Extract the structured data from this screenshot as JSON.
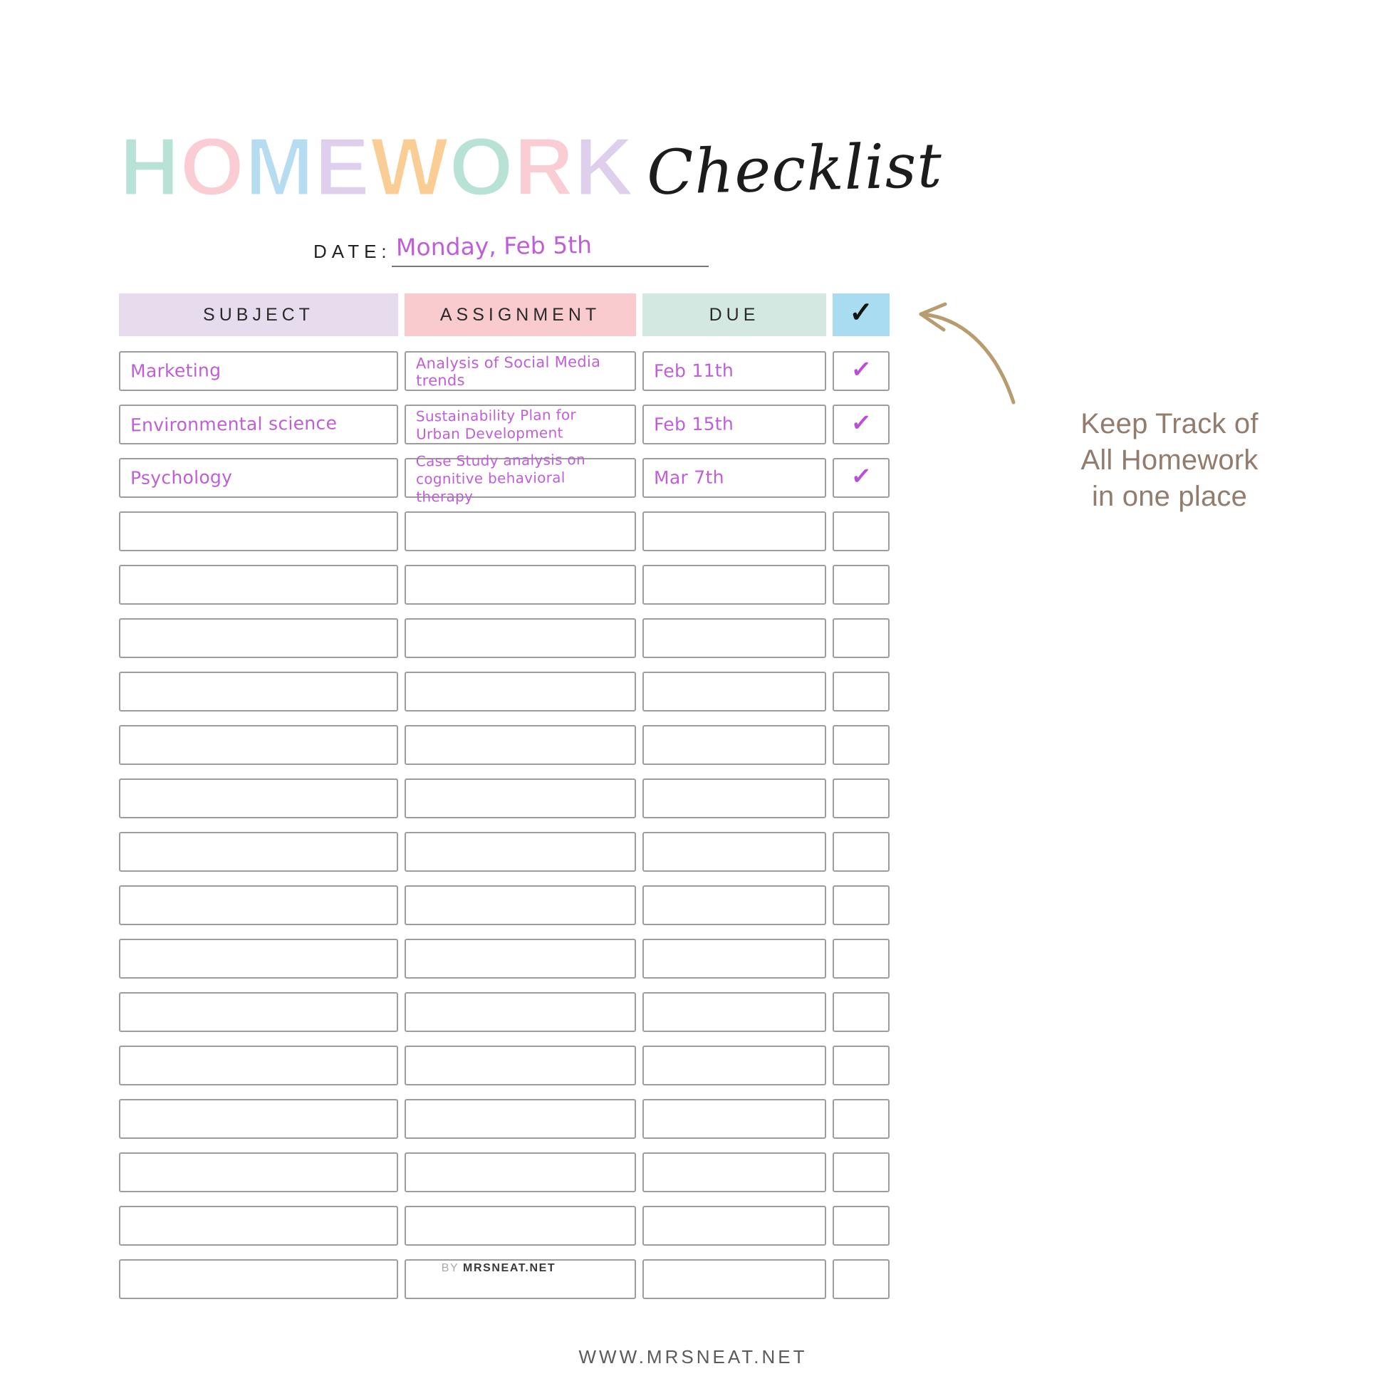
{
  "title": {
    "word_letters": [
      {
        "char": "H",
        "color": "#b9e2d6"
      },
      {
        "char": "O",
        "color": "#f9cdd3"
      },
      {
        "char": "M",
        "color": "#b6dcf2"
      },
      {
        "char": "E",
        "color": "#ded0ec"
      },
      {
        "char": "W",
        "color": "#f9cd93"
      },
      {
        "char": "O",
        "color": "#b9e2d6"
      },
      {
        "char": "R",
        "color": "#f9cdd3"
      },
      {
        "char": "K",
        "color": "#ded0ec"
      }
    ],
    "word_plain": "HOMEWORK",
    "script": "Checklist"
  },
  "date": {
    "label": "DATE:",
    "value": "Monday, Feb 5th",
    "placeholder": ""
  },
  "table": {
    "headers": {
      "subject": "SUBJECT",
      "assignment": "ASSIGNMENT",
      "due": "DUE",
      "check": "✓"
    },
    "header_colors": {
      "subject": "#e7dcee",
      "assignment": "#f9cbce",
      "due": "#d4e8e2",
      "check": "#a9dcf0"
    },
    "ink_color": "#bf5fd8",
    "filled_rows": [
      {
        "subject": "Marketing",
        "assignment": "Analysis of Social Media trends",
        "due": "Feb 11th",
        "checked": true,
        "check_glyph": "✓"
      },
      {
        "subject": "Environmental science",
        "assignment": "Sustainability Plan for Urban Development",
        "due": "Feb 15th",
        "checked": true,
        "check_glyph": "✓"
      },
      {
        "subject": "Psychology",
        "assignment": "Case Study analysis on cognitive behavioral therapy",
        "due": "Mar 7th",
        "checked": true,
        "check_glyph": "✓"
      }
    ],
    "empty_row_count": 15,
    "total_row_count": 18
  },
  "annotation": {
    "line1": "Keep Track of",
    "line2": "All Homework",
    "line3": "in one place",
    "color": "#917c6e",
    "arrow_color": "#b89b6e"
  },
  "footer": {
    "by_word": "BY",
    "by_site": "MRSNEAT.NET",
    "website": "WWW.MRSNEAT.NET"
  }
}
